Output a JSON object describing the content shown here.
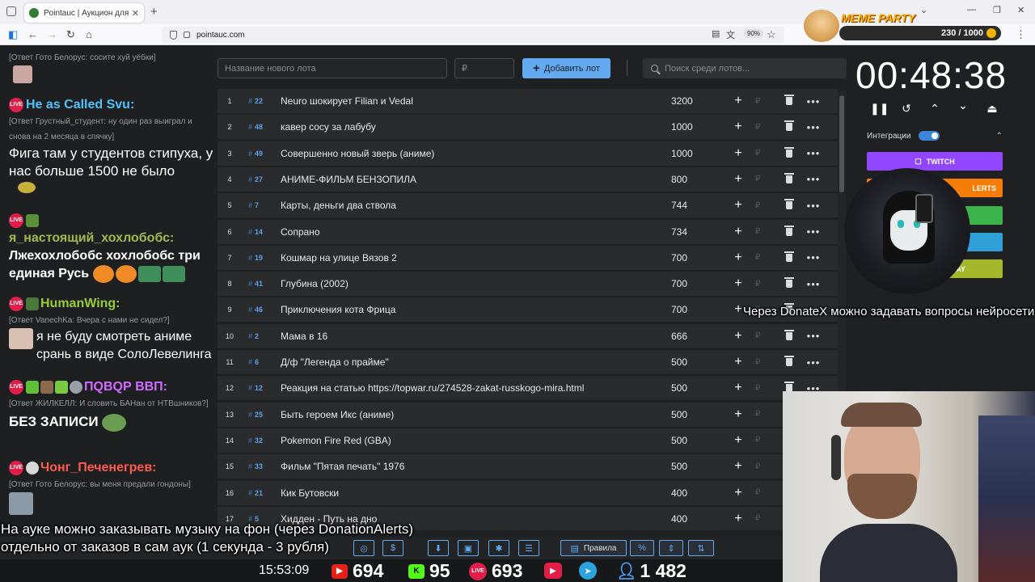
{
  "browser": {
    "tab_title": "Pointauc | Аукцион для стримеров",
    "url": "pointauc.com",
    "zoom": "90%"
  },
  "meme_party": {
    "title": "MEME PARTY",
    "score": "230 / 1000"
  },
  "chat": {
    "messages": [
      {
        "reply": "[Ответ Гото Белоруc: сосите хуй уёбки]"
      },
      {
        "user": "He as Called Svu:",
        "user_color": "#4fc3f7",
        "reply": "[Ответ Грустный_студент: ну один раз выиграл и снова на 2 месяца в спячку]",
        "text": "Фига там у студентов стипуха, у нас больше 1500 не было"
      },
      {
        "user": "я_настоящий_хохлобобс:",
        "user_color": "#a5b84a",
        "text": "Лжехохлобобс хохлобобс три единая Русь"
      },
      {
        "user": "HumanWing:",
        "user_color": "#9acd32",
        "reply": "[Ответ VanechKa: Вчера с нами не сидел?]",
        "text": "я не буду смотреть аниме срань в виде СолоЛевелинга"
      },
      {
        "user": "ПQBQР ВВП:",
        "user_color": "#d16bff",
        "reply": "[Ответ ЖИЛКЕЛЛ: И словить БАНан от НТВшников?]",
        "text": "БЕЗ ЗАПИСИ"
      },
      {
        "user": "Чонг_Печенегрев:",
        "user_color": "#ff5a4e",
        "reply": "[Ответ Гото Белоруc: вы меня предали гондоны]"
      }
    ]
  },
  "toolbar": {
    "lot_name_placeholder": "Название нового лота",
    "amount_placeholder": "₽",
    "add_lot_label": "Добавить лот",
    "search_placeholder": "Поиск среди лотов..."
  },
  "lots": [
    {
      "index": "1",
      "id": "22",
      "name": "Neuro шокирует Filian и Vedal",
      "amount": "3200"
    },
    {
      "index": "2",
      "id": "48",
      "name": "кавер сосу за лабубу",
      "amount": "1000"
    },
    {
      "index": "3",
      "id": "49",
      "name": "Совершенно новый зверь (аниме)",
      "amount": "1000"
    },
    {
      "index": "4",
      "id": "27",
      "name": "АНИМЕ-ФИЛЬМ БЕНЗОПИЛА",
      "amount": "800"
    },
    {
      "index": "5",
      "id": "7",
      "name": "Карты, деньги два ствола",
      "amount": "744"
    },
    {
      "index": "6",
      "id": "14",
      "name": "Сопрано",
      "amount": "734"
    },
    {
      "index": "7",
      "id": "19",
      "name": "Кошмар на улице Вязов 2",
      "amount": "700"
    },
    {
      "index": "8",
      "id": "41",
      "name": "Глубина (2002)",
      "amount": "700"
    },
    {
      "index": "9",
      "id": "46",
      "name": "Приключения кота Фрица",
      "amount": "700"
    },
    {
      "index": "10",
      "id": "2",
      "name": "Мама в 16",
      "amount": "666"
    },
    {
      "index": "11",
      "id": "6",
      "name": "Д/ф \"Легенда о прайме\"",
      "amount": "500"
    },
    {
      "index": "12",
      "id": "12",
      "name": "Реакция на статью https://topwar.ru/274528-zakat-russkogo-mira.html",
      "amount": "500"
    },
    {
      "index": "13",
      "id": "25",
      "name": "Быть героем Икс (аниме)",
      "amount": "500"
    },
    {
      "index": "14",
      "id": "32",
      "name": "Pokemon Fire Red (GBA)",
      "amount": "500"
    },
    {
      "index": "15",
      "id": "33",
      "name": "Фильм \"Пятая печать\" 1976",
      "amount": "500"
    },
    {
      "index": "16",
      "id": "21",
      "name": "Кик Бутовски",
      "amount": "400"
    },
    {
      "index": "17",
      "id": "5",
      "name": "Хидден - Путь на дно",
      "amount": "400"
    }
  ],
  "rub_symbol": "₽",
  "timer": {
    "value": "00:48:38",
    "integrations_label": "Интеграции",
    "buttons": [
      {
        "label": "TWITCH",
        "color": "#9146ff"
      },
      {
        "label": "DONATIONALERTS",
        "color": "#f57d07"
      },
      {
        "label": "",
        "color": "#3cb34a"
      },
      {
        "label": "",
        "color": "#2fa0d8"
      },
      {
        "label": "DONATEPAY",
        "color": "#a5b82a"
      }
    ]
  },
  "bottom_toolbar": {
    "rules_label": "Правила"
  },
  "status": {
    "clock": "15:53:09",
    "youtube": "694",
    "kick": "95",
    "vk_live": "693",
    "telegram_total": "1 482"
  },
  "captions": {
    "overlay_right": "Через DonateX можно задавать вопросы нейросети",
    "overlay_bottom_1": "На ауке можно заказывать музыку на фон (через DonationAlerts)",
    "overlay_bottom_2": "отдельно от заказов в сам аук (1 секунда - 3 рубля)"
  }
}
